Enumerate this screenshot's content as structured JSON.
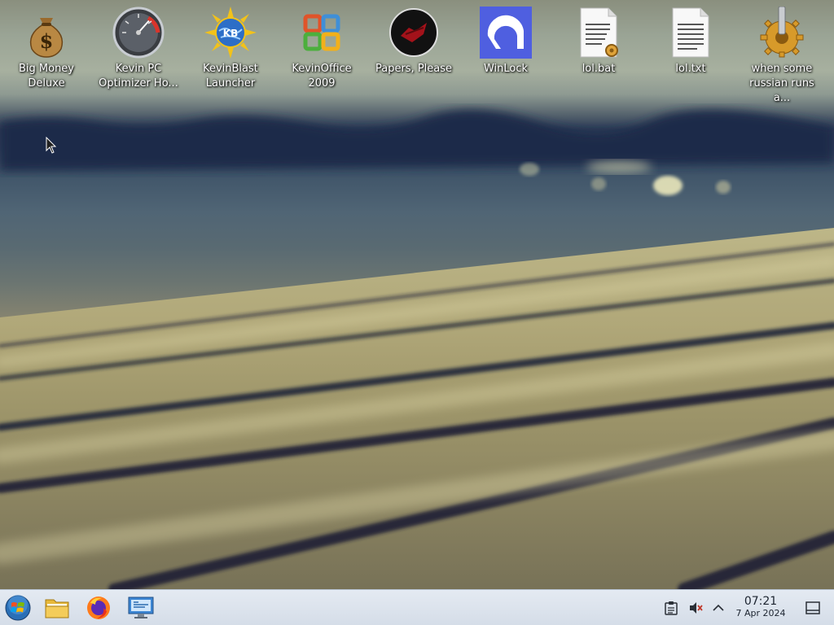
{
  "desktop": {
    "icons": [
      {
        "label": "Big Money Deluxe",
        "icon": "money-bag-icon"
      },
      {
        "label": "Kevin PC Optimizer Ho...",
        "icon": "speedometer-icon"
      },
      {
        "label": "KevinBlast Launcher",
        "icon": "sun-globe-icon"
      },
      {
        "label": "KevinOffice 2009",
        "icon": "office-logo-icon"
      },
      {
        "label": "Papers, Please",
        "icon": "papers-please-icon"
      },
      {
        "label": "WinLock",
        "icon": "winlock-icon"
      },
      {
        "label": "lol.bat",
        "icon": "batch-file-icon"
      },
      {
        "label": "lol.txt",
        "icon": "text-file-icon"
      },
      {
        "label": "when some russian runs a...",
        "icon": "gear-icon"
      }
    ]
  },
  "taskbar": {
    "pinned": [
      {
        "name": "start-button",
        "icon": "windows-orb-icon"
      },
      {
        "name": "file-manager-button",
        "icon": "folder-icon"
      },
      {
        "name": "firefox-button",
        "icon": "firefox-icon"
      },
      {
        "name": "system-settings-button",
        "icon": "monitor-settings-icon"
      }
    ],
    "tray": {
      "icons": [
        "clipboard-icon",
        "volume-muted-icon",
        "chevron-up-icon"
      ],
      "clock": {
        "time": "07:21",
        "date": "7 Apr 2024"
      },
      "show_desktop_icon": "show-desktop-icon"
    }
  },
  "colors": {
    "taskbar_bg": "#dde4ee",
    "label_text": "#ffffff",
    "clock_text": "#1c2430"
  }
}
